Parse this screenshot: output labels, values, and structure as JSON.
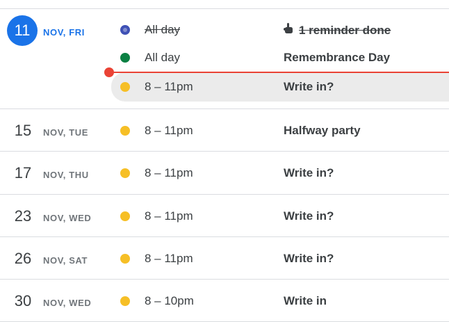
{
  "days": [
    {
      "day_number": "11",
      "day_label": "NOV, FRI",
      "is_today": true,
      "events": [
        {
          "time": "All day",
          "title": "1 reminder done",
          "dot_color": "#3f51b5",
          "done": true,
          "icon": "reminder-hand-icon"
        },
        {
          "time": "All day",
          "title": "Remembrance Day",
          "dot_color": "#0b8043",
          "done": false
        },
        {
          "time": "8 – 11pm",
          "title": "Write in?",
          "dot_color": "#f6bf26",
          "done": false
        }
      ]
    },
    {
      "day_number": "15",
      "day_label": "NOV, TUE",
      "events": [
        {
          "time": "8 – 11pm",
          "title": "Halfway party",
          "dot_color": "#f6bf26"
        }
      ]
    },
    {
      "day_number": "17",
      "day_label": "NOV, THU",
      "events": [
        {
          "time": "8 – 11pm",
          "title": "Write in?",
          "dot_color": "#f6bf26"
        }
      ]
    },
    {
      "day_number": "23",
      "day_label": "NOV, WED",
      "events": [
        {
          "time": "8 – 11pm",
          "title": "Write in?",
          "dot_color": "#f6bf26"
        }
      ]
    },
    {
      "day_number": "26",
      "day_label": "NOV, SAT",
      "events": [
        {
          "time": "8 – 11pm",
          "title": "Write in?",
          "dot_color": "#f6bf26"
        }
      ]
    },
    {
      "day_number": "30",
      "day_label": "NOV, WED",
      "events": [
        {
          "time": "8 – 10pm",
          "title": "Write in",
          "dot_color": "#f6bf26"
        }
      ]
    }
  ],
  "colors": {
    "accent": "#1a73e8",
    "now_indicator": "#ea4335",
    "divider": "#dadce0",
    "highlight_bg": "#ebebeb"
  }
}
